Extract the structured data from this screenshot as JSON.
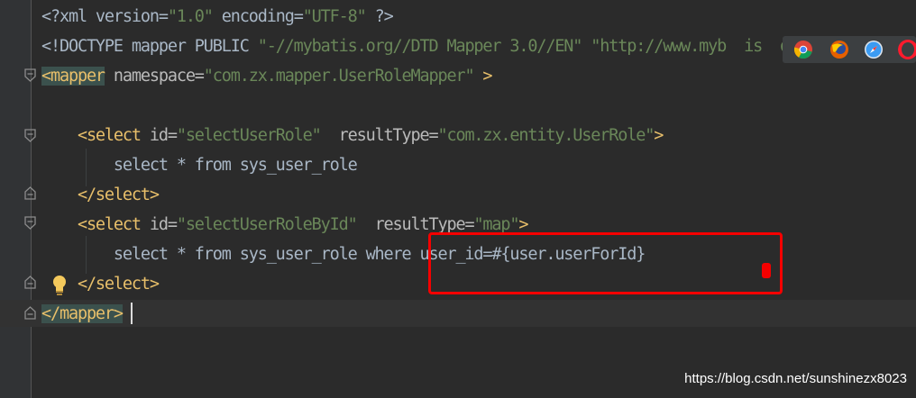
{
  "editor": {
    "lines": [
      {
        "parts": [
          {
            "t": "<?xml version=",
            "c": "txt"
          },
          {
            "t": "\"1.0\"",
            "c": "str"
          },
          {
            "t": " encoding=",
            "c": "txt"
          },
          {
            "t": "\"UTF-8\"",
            "c": "str"
          },
          {
            "t": " ?>",
            "c": "txt"
          }
        ]
      },
      {
        "parts": [
          {
            "t": "<!DOCTYPE mapper PUBLIC ",
            "c": "txt"
          },
          {
            "t": "\"-//mybatis.org//DTD Mapper 3.0//EN\"",
            "c": "str"
          },
          {
            "t": " ",
            "c": "txt"
          },
          {
            "t": "\"http://www.myb",
            "c": "str"
          },
          {
            "t": "  is  or  dtd",
            "c": "str"
          }
        ]
      },
      {
        "parts": [
          {
            "t": "<mapper",
            "c": "tag hl2"
          },
          {
            "t": " namespace=",
            "c": "attr"
          },
          {
            "t": "\"com.zx.mapper.UserRoleMapper\"",
            "c": "str"
          },
          {
            "t": " >",
            "c": "tag"
          }
        ]
      },
      {
        "parts": []
      },
      {
        "parts": [
          {
            "t": "    <select",
            "c": "tag"
          },
          {
            "t": " id=",
            "c": "attr"
          },
          {
            "t": "\"selectUserRole\"",
            "c": "str"
          },
          {
            "t": "  resultType=",
            "c": "attr"
          },
          {
            "t": "\"com.zx.entity.UserRole\"",
            "c": "str"
          },
          {
            "t": ">",
            "c": "tag"
          }
        ]
      },
      {
        "parts": [
          {
            "t": "        select * from sys_user_role",
            "c": "txt"
          }
        ]
      },
      {
        "parts": [
          {
            "t": "    </select>",
            "c": "tag"
          }
        ]
      },
      {
        "parts": [
          {
            "t": "    <select",
            "c": "tag"
          },
          {
            "t": " id=",
            "c": "attr"
          },
          {
            "t": "\"selectUserRoleById\"",
            "c": "str"
          },
          {
            "t": "  resultType=",
            "c": "attr"
          },
          {
            "t": "\"map\"",
            "c": "str"
          },
          {
            "t": ">",
            "c": "tag"
          }
        ]
      },
      {
        "parts": [
          {
            "t": "        select * from sys_user_role where user_id=#{user.userForId}",
            "c": "txt"
          }
        ]
      },
      {
        "parts": [
          {
            "t": "    </select>",
            "c": "tag"
          }
        ]
      },
      {
        "parts": [
          {
            "t": "</mapper>",
            "c": "tag hl2"
          }
        ]
      }
    ]
  },
  "browser_icons": [
    "chrome-icon",
    "firefox-icon",
    "safari-icon",
    "opera-icon"
  ],
  "watermark": "https://blog.csdn.net/sunshinezx8023",
  "colors": {
    "background": "#2b2b2b",
    "tag": "#e8bf6a",
    "string": "#6a8759",
    "text": "#a9b7c6",
    "highlight_box": "#f50000"
  }
}
